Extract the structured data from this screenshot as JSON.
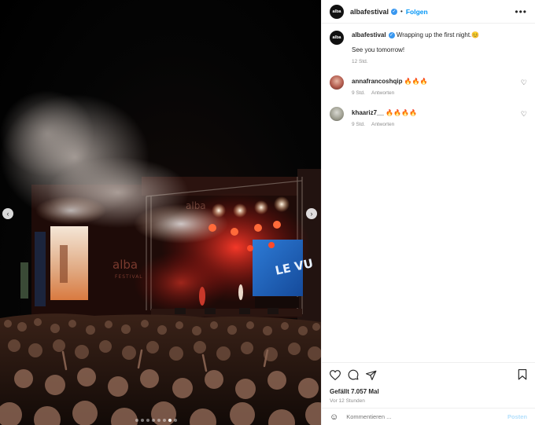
{
  "post": {
    "account": {
      "username": "albafestival",
      "avatar_text": "alba",
      "verified_icon": "verified-badge-icon",
      "follow_label": "Folgen",
      "separator": "•",
      "more_icon": "•••"
    },
    "caption": {
      "username": "albafestival",
      "text_line1": "Wrapping up the first night.😊",
      "text_line2": "See you tomorrow!",
      "time": "12 Std."
    },
    "comments": [
      {
        "username": "annafrancoshqip",
        "text": "🔥🔥🔥",
        "time": "9 Std.",
        "reply_label": "Antworten"
      },
      {
        "username": "khaariz7__",
        "text": "🔥🔥🔥🔥",
        "time": "9 Std.",
        "reply_label": "Antworten"
      }
    ],
    "likes": "Gefällt 7.057 Mal",
    "posted_ago": "Vor 12 Stunden",
    "composer": {
      "emoji_icon": "☺",
      "placeholder": "Kommentieren ...",
      "post_label": "Posten"
    },
    "media": {
      "stage_brand": "alba",
      "stage_sub": "FESTIVAL",
      "screen_text": "LE VU",
      "carousel_count": 8,
      "carousel_active_index": 6
    },
    "colors": {
      "link_blue": "#0095f6",
      "verified_blue": "#3897f0",
      "muted_text": "#8e8e8e"
    }
  }
}
